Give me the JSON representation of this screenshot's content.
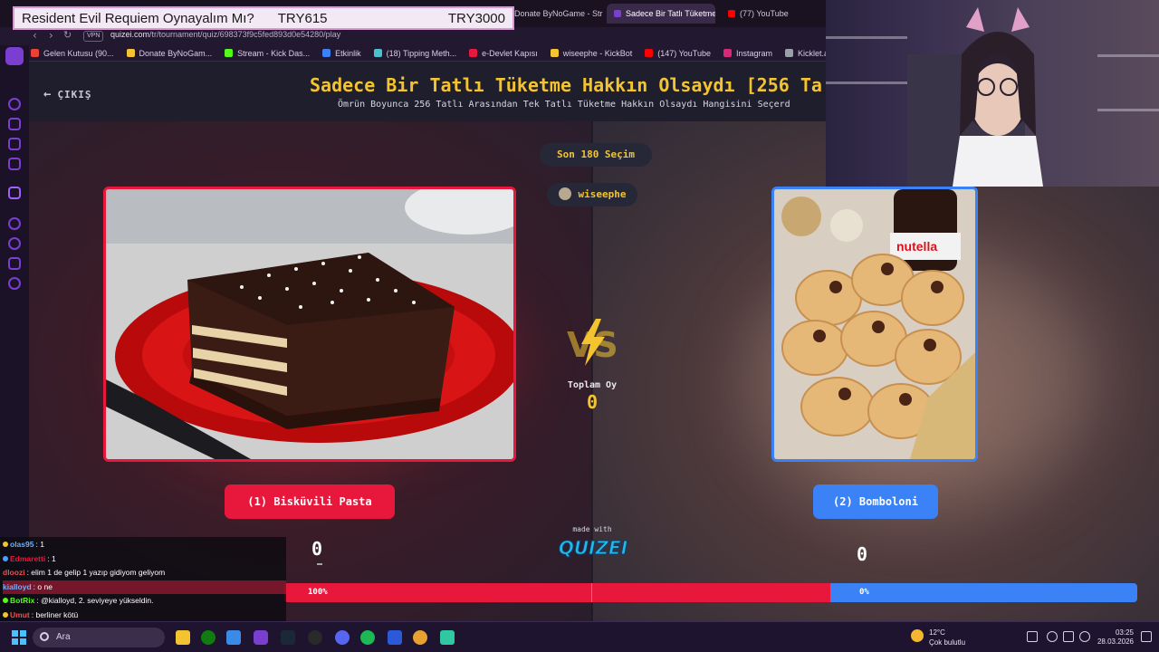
{
  "overlay": {
    "title": "Resident Evil Requiem Oynayalım Mı?",
    "goal_current": "TRY615",
    "goal_target": "TRY3000"
  },
  "browser": {
    "tabs": [
      {
        "label": "Donate ByNoGame - Str",
        "active": false
      },
      {
        "label": "Sadece Bir Tatlı Tüketme",
        "active": true
      },
      {
        "label": "(77) YouTube",
        "active": false
      }
    ],
    "vpn_label": "VPN",
    "url_host": "quizei.com",
    "url_path": "/tr/tournament/quiz/698373f9c5fed893d0e54280/play",
    "bookmarks": [
      {
        "label": "Gelen Kutusu (90...",
        "color": "#ea4335"
      },
      {
        "label": "Donate ByNoGam...",
        "color": "#f4c430"
      },
      {
        "label": "Stream - Kick Das...",
        "color": "#53fc18"
      },
      {
        "label": "Etkinlik",
        "color": "#3b82f6"
      },
      {
        "label": "(18) Tipping Meth...",
        "color": "#4ac0d0"
      },
      {
        "label": "e-Devlet Kapısı",
        "color": "#e8183c"
      },
      {
        "label": "wiseephe - KickBot",
        "color": "#f4c430"
      },
      {
        "label": "(147) YouTube",
        "color": "#ff0000"
      },
      {
        "label": "Instagram",
        "color": "#d62976"
      },
      {
        "label": "Kicklet.app - Kick...",
        "color": "#9aa0a8"
      }
    ]
  },
  "quiz": {
    "back_label": "ÇIKIŞ",
    "title": "Sadece Bir Tatlı Tüketme Hakkın Olsaydı [256 Ta",
    "subtitle": "Ömrün Boyunca 256 Tatlı Arasından Tek Tatlı Tüketme Hakkın Olsaydı Hangisini Seçerd",
    "last_choices_label": "Son 180 Seçim",
    "voter_name": "wiseephe",
    "total_votes_label": "Toplam Oy",
    "total_votes_value": "0",
    "made_with": "made with",
    "brand": "QUIZEI",
    "left": {
      "label": "(1) Bisküvili Pasta",
      "count": "0",
      "percent_label": "100%",
      "share": 0.64,
      "color": "#e8183c"
    },
    "right": {
      "label": "(2) Bomboloni",
      "count": "0",
      "percent_label": "0%",
      "color": "#3b82f6"
    }
  },
  "chat": [
    {
      "user": "olas95",
      "msg": "1",
      "color": "#6ab0ff",
      "highlight": false
    },
    {
      "user": "Edmaretti",
      "msg": "1",
      "color": "#e8183c",
      "highlight": false
    },
    {
      "user": "dloozi",
      "msg": "elim 1 de gelip 1 yazıp gidiyom geliyom",
      "color": "#e85050",
      "highlight": false
    },
    {
      "user": "kialloyd",
      "msg": "o ne",
      "color": "#6ab0ff",
      "highlight": true
    },
    {
      "user": "BotRix",
      "msg": "@kialloyd, 2. seviyeye yükseldin.",
      "color": "#53fc18",
      "highlight": false
    },
    {
      "user": "Umut",
      "msg": "berliner kötü",
      "color": "#e85050",
      "highlight": false
    }
  ],
  "taskbar": {
    "search_placeholder": "Ara",
    "weather_temp": "12°C",
    "weather_desc": "Çok bulutlu",
    "time": "03:25",
    "date": "28.03.2026"
  }
}
